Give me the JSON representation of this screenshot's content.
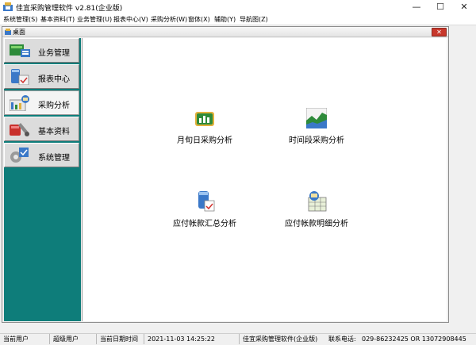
{
  "window": {
    "title": "佳宜采购管理软件 v2.81(企业版)",
    "minimize": "—",
    "maximize": "☐",
    "close": "✕"
  },
  "menubar": {
    "items": [
      "系统管理(S)",
      "基本资料(T)",
      "业务管理(U)",
      "报表中心(V)",
      "采购分析(W)",
      "窗体(X)",
      "辅助(Y)",
      "导航图(Z)"
    ]
  },
  "child_window": {
    "title": "桌面",
    "close": "✕"
  },
  "nav": {
    "items": [
      {
        "label": "业务管理",
        "icon": "business-icon",
        "active": false
      },
      {
        "label": "报表中心",
        "icon": "report-icon",
        "active": false
      },
      {
        "label": "采购分析",
        "icon": "analysis-icon",
        "active": true
      },
      {
        "label": "基本资料",
        "icon": "tools-icon",
        "active": false
      },
      {
        "label": "系统管理",
        "icon": "system-icon",
        "active": false
      }
    ]
  },
  "content": {
    "tiles": [
      {
        "label": "月旬日采购分析",
        "icon": "calendar-chart-icon"
      },
      {
        "label": "时间段采购分析",
        "icon": "area-chart-icon"
      },
      {
        "label": "应付帐款汇总分析",
        "icon": "database-check-icon"
      },
      {
        "label": "应付帐款明细分析",
        "icon": "grid-detail-icon"
      }
    ]
  },
  "statusbar": {
    "user_label": "当前用户",
    "user_value": "超级用户",
    "datetime_label": "当前日期时间",
    "datetime_value": "2021-11-03 14:25:22",
    "product": "佳宜采购管理软件(企业版)",
    "phone_label": "联系电话:",
    "phone_value": "029-86232425  OR  13072908445"
  },
  "colors": {
    "nav_background": "#0e7d7a",
    "child_close": "#c8382c"
  }
}
